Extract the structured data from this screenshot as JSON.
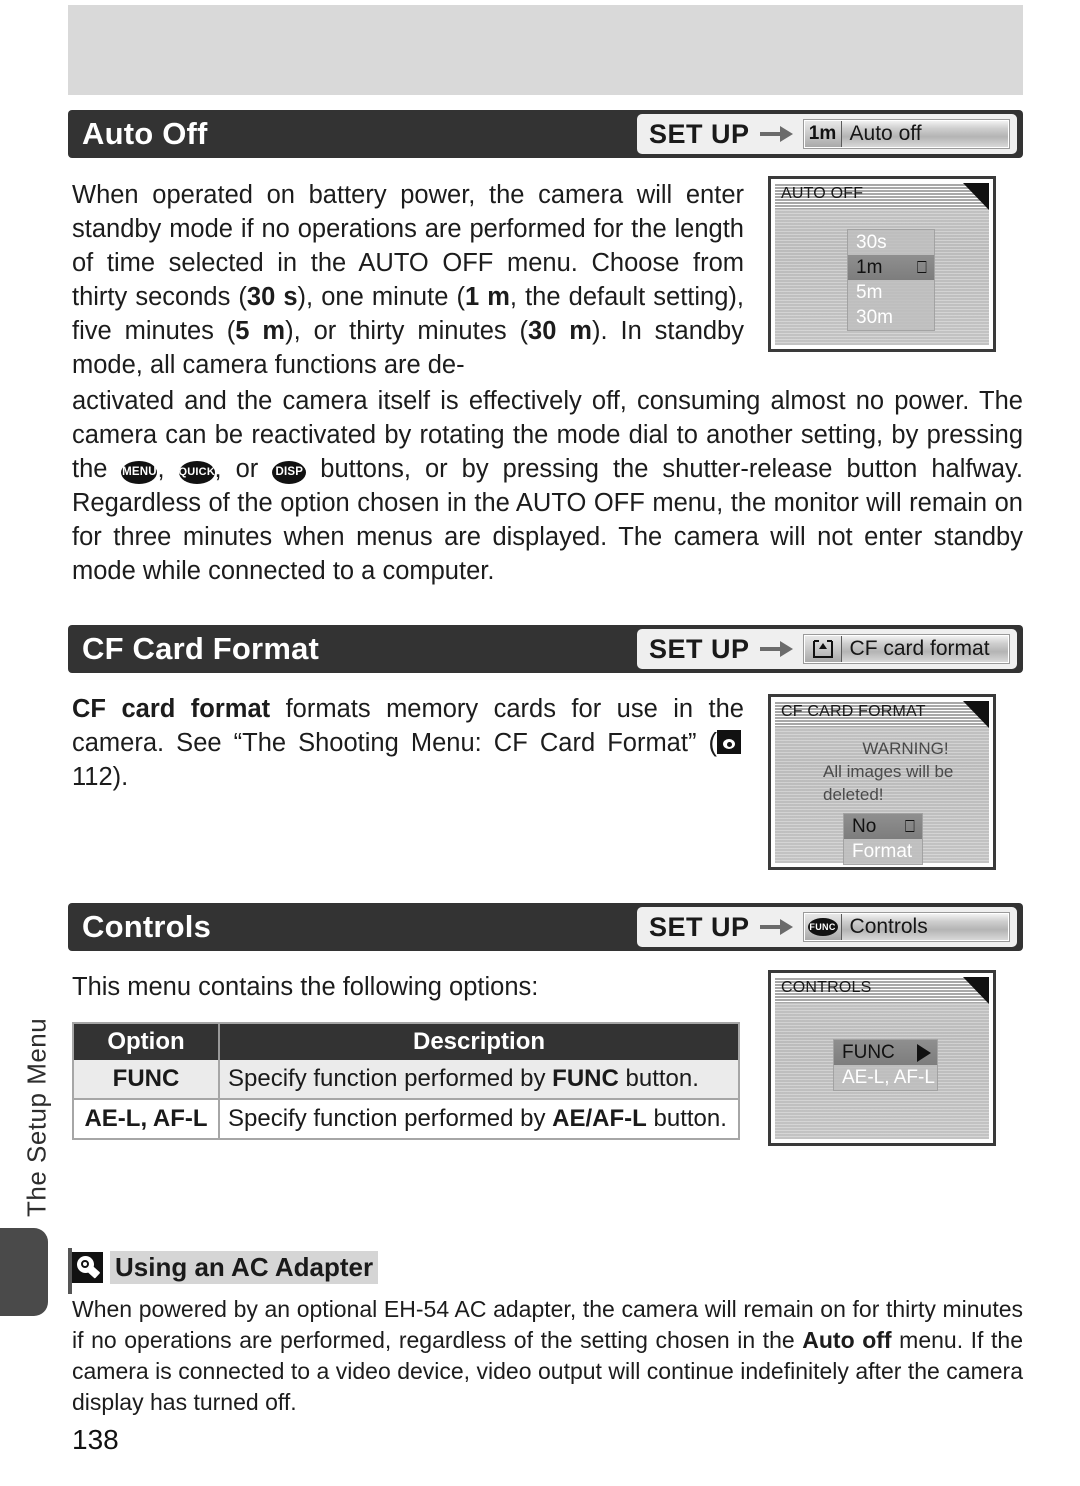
{
  "page": {
    "number": "138",
    "side_tab_label": "The Setup Menu"
  },
  "sections": [
    {
      "id": "auto-off",
      "title": "Auto Off",
      "breadcrumb": {
        "root": "SET UP",
        "icon": "1m",
        "icon_name": "one-minute-icon",
        "label": "Auto off"
      },
      "screen": {
        "title": "AUTO OFF",
        "rows": [
          {
            "label": "30s",
            "selected": false
          },
          {
            "label": "1m",
            "selected": true,
            "marker": "enter"
          },
          {
            "label": "5m",
            "selected": false
          },
          {
            "label": "30m",
            "selected": false
          }
        ]
      }
    },
    {
      "id": "cf-card-format",
      "title": "CF Card Format",
      "breadcrumb": {
        "root": "SET UP",
        "icon": "card-eject-icon",
        "icon_name": "card-eject-icon",
        "label": "CF card format"
      },
      "screen": {
        "title": "CF CARD FORMAT",
        "warning_lines": [
          "WARNING!",
          "All images will be",
          "deleted!"
        ],
        "rows": [
          {
            "label": "No",
            "selected": true,
            "marker": "enter"
          },
          {
            "label": "Format",
            "selected": false
          }
        ]
      }
    },
    {
      "id": "controls",
      "title": "Controls",
      "breadcrumb": {
        "root": "SET UP",
        "icon": "FUNC",
        "icon_name": "func-button-icon",
        "label": "Controls"
      },
      "screen": {
        "title": "CONTROLS",
        "rows": [
          {
            "label": "FUNC",
            "selected": true,
            "marker": "triangle"
          },
          {
            "label": "AE-L, AF-L",
            "selected": false
          }
        ]
      }
    }
  ],
  "auto_off_text": {
    "p1_a": "When operated on battery power, the camera will enter standby mode if no operations are performed for the length of time selected in the AUTO OFF menu. Choose from thirty seconds (",
    "p1_b": "30 s",
    "p1_c": "), one minute (",
    "p1_d": "1 m",
    "p1_e": ", the default setting), five minutes (",
    "p1_f": "5 m",
    "p1_g": "), or thirty minutes (",
    "p1_h": "30 m",
    "p1_i": "). In standby mode, all camera functions are de-",
    "p2_a": "activated and the camera itself is effectively off, consuming almost no power. The camera can be reactivated by rotating the mode dial to another setting, by pressing the ",
    "btn_menu": "MENU",
    "p2_b": ", ",
    "btn_quick": "QUICK",
    "p2_c": ", or ",
    "btn_disp": "DISP",
    "p2_d": " buttons, or by pressing the shutter-release button halfway.  Regardless of the option chosen in the AUTO OFF menu, the monitor will remain on for three minutes when menus are displayed.  The camera will not enter standby mode while connected to a computer."
  },
  "cf_text": {
    "bold_lead": "CF card format",
    "rest": " formats memory cards for use in the camera.  See “The Shooting Menu: CF Card Format” (",
    "page_ref": "112",
    "tail": ")."
  },
  "controls_text": {
    "intro": "This menu contains the following options:",
    "table": {
      "headers": [
        "Option",
        "Description"
      ],
      "rows": [
        {
          "option": "FUNC",
          "desc_a": "Specify function performed by ",
          "desc_bold": "FUNC",
          "desc_b": " button."
        },
        {
          "option": "AE-L, AF-L",
          "desc_a": "Specify function performed by ",
          "desc_bold": "AE/AF-L",
          "desc_b": " button."
        }
      ]
    }
  },
  "note": {
    "title": "Using an AC Adapter",
    "body_a": "When powered by an optional EH-54 AC adapter, the camera will remain on for thirty minutes if no operations are performed, regardless of the setting chosen in the ",
    "body_bold1": "Auto off",
    "body_b": " menu.  If the camera is connected to a video device, video output will continue indefinitely after the camera display has turned off."
  },
  "colors": {
    "heading_bar": "#333333",
    "band": "#d9d9d9",
    "table_head": "#333333"
  }
}
